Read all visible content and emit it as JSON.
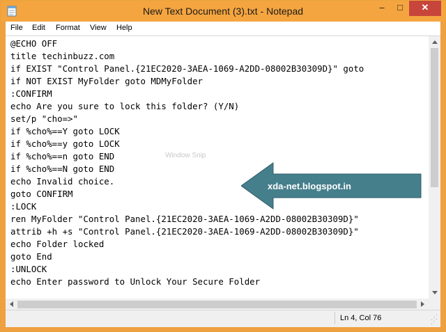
{
  "window": {
    "title": "New Text Document (3).txt - Notepad",
    "controls": {
      "minimize": "–",
      "maximize": "□",
      "close": "✕"
    },
    "accent_color": "#f5a540"
  },
  "menu": [
    "File",
    "Edit",
    "Format",
    "View",
    "Help"
  ],
  "document": {
    "lines": [
      "@ECHO OFF",
      "title techinbuzz.com",
      "if EXIST \"Control Panel.{21EC2020-3AEA-1069-A2DD-08002B30309D}\" goto",
      "if NOT EXIST MyFolder goto MDMyFolder",
      ":CONFIRM",
      "echo Are you sure to lock this folder? (Y/N)",
      "set/p \"cho=>\"",
      "if %cho%==Y goto LOCK",
      "if %cho%==y goto LOCK",
      "if %cho%==n goto END",
      "if %cho%==N goto END",
      "echo Invalid choice.",
      "goto CONFIRM",
      ":LOCK",
      "ren MyFolder \"Control Panel.{21EC2020-3AEA-1069-A2DD-08002B30309D}\"",
      "attrib +h +s \"Control Panel.{21EC2020-3AEA-1069-A2DD-08002B30309D}\"",
      "echo Folder locked",
      "goto End",
      ":UNLOCK",
      "echo Enter password to Unlock Your Secure Folder"
    ]
  },
  "overlay": {
    "watermark": "Window Snip",
    "arrow_label": "xda-net.blogspot.in",
    "arrow_color": "#457f8c"
  },
  "status": {
    "position": "Ln 4, Col 76"
  }
}
